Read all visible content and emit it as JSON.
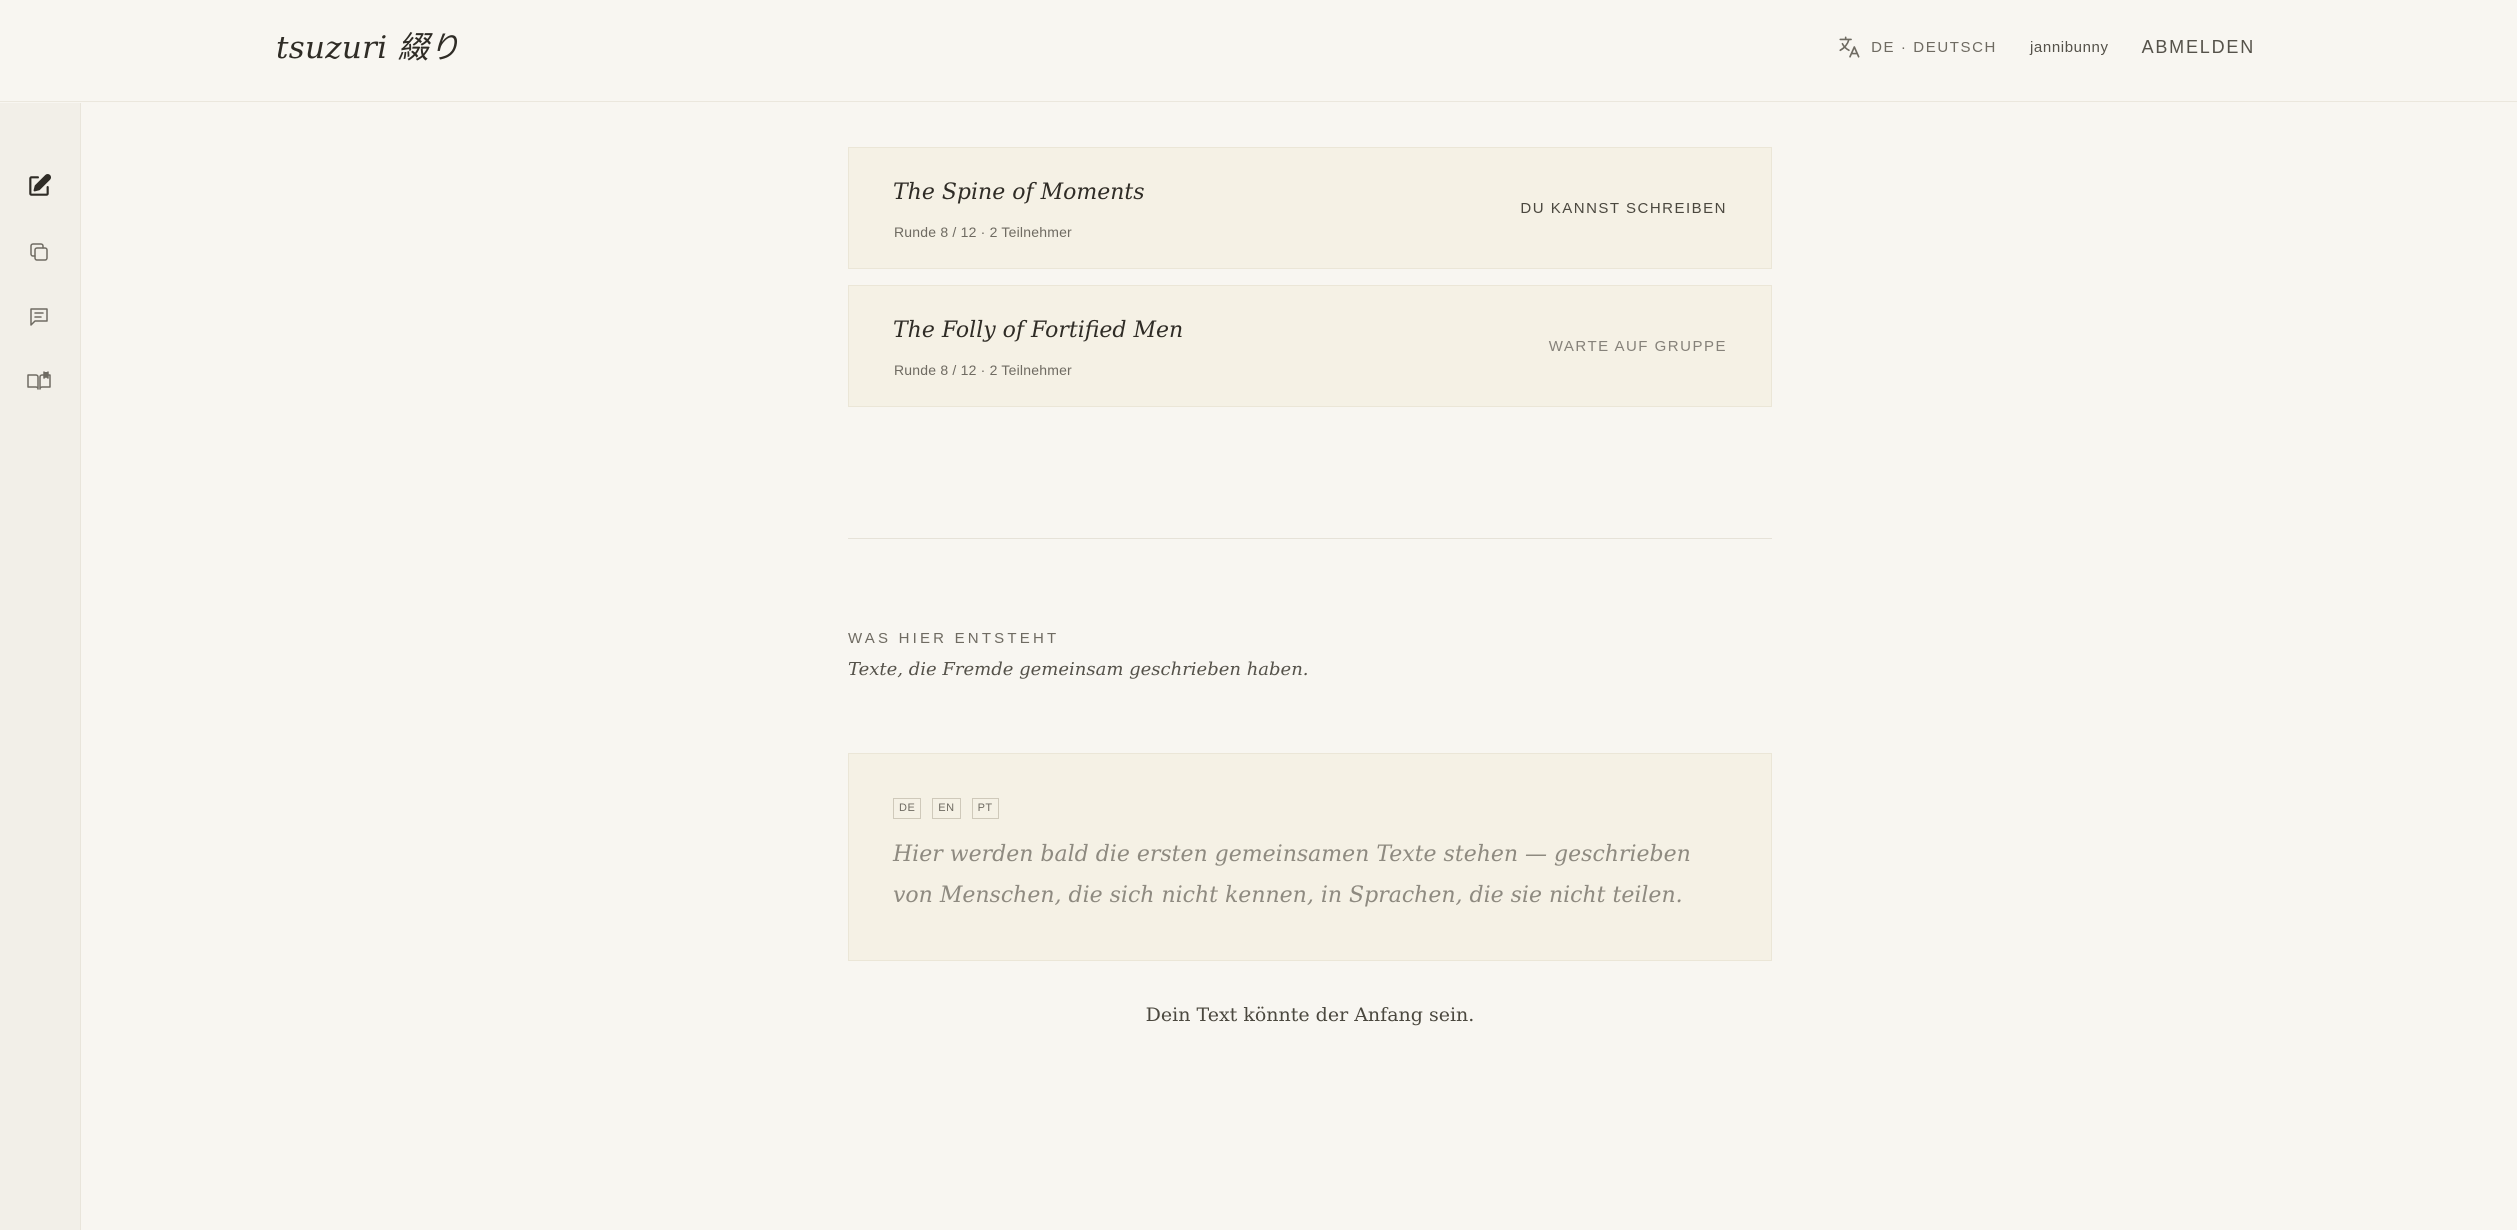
{
  "header": {
    "logo": "tsuzuri 綴り",
    "language_label": "DE · DEUTSCH",
    "username": "jannibunny",
    "logout_label": "ABMELDEN"
  },
  "sidebar": {
    "items": [
      {
        "icon": "edit-icon",
        "active": true
      },
      {
        "icon": "copy-icon",
        "active": false
      },
      {
        "icon": "message-icon",
        "active": false
      },
      {
        "icon": "book-icon",
        "active": false
      }
    ]
  },
  "games": [
    {
      "title": "The Spine of Moments",
      "meta": "Runde 8 / 12 · 2 Teilnehmer",
      "status": "DU KANNST SCHREIBEN"
    },
    {
      "title": "The Folly of Fortified Men",
      "meta": "Runde 8 / 12 · 2 Teilnehmer",
      "status": "WARTE AUF GRUPPE"
    }
  ],
  "section": {
    "kicker": "WAS HIER ENTSTEHT",
    "subtitle": "Texte, die Fremde gemeinsam geschrieben haben."
  },
  "story_card": {
    "languages": [
      "DE",
      "EN",
      "PT"
    ],
    "text": "Hier werden bald die ersten gemeinsamen Texte stehen — geschrieben von Menschen, die sich nicht kennen, in Sprachen, die sie nicht teilen."
  },
  "cta": "Dein Text könnte der Anfang sein.",
  "colors": {
    "background": "#f8f6f1",
    "card": "#f5f1e5",
    "sidebar": "#f2efe8",
    "text": "#3a372f"
  }
}
